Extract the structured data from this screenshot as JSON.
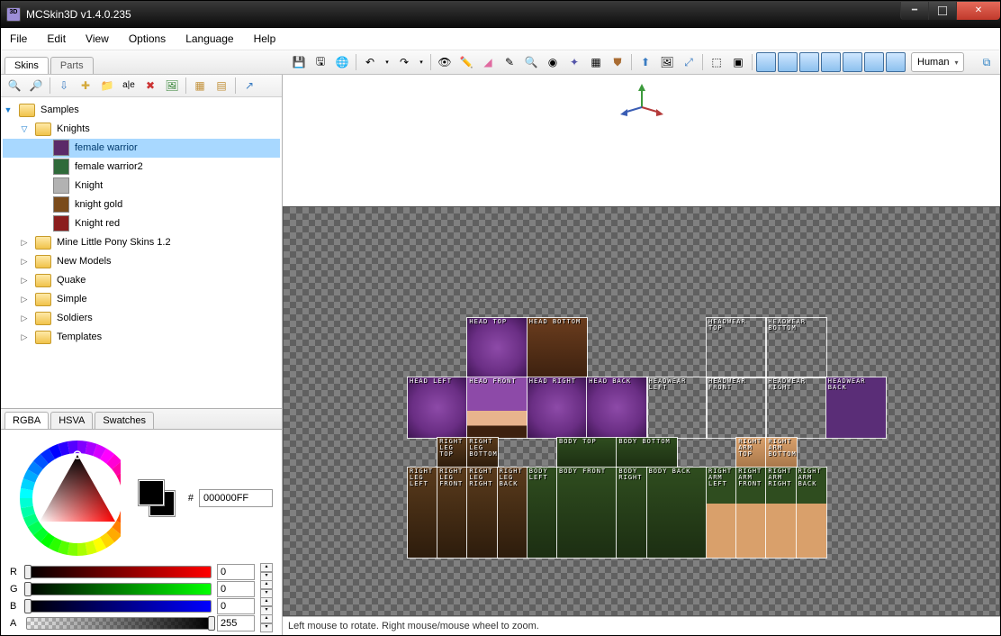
{
  "window": {
    "title": "MCSkin3D  v1.4.0.235"
  },
  "menu": [
    "File",
    "Edit",
    "View",
    "Options",
    "Language",
    "Help"
  ],
  "fileTabs": [
    {
      "label": "Skins",
      "active": true
    },
    {
      "label": "Parts",
      "active": false
    }
  ],
  "model_selector": "Human",
  "tree": {
    "root": "Samples",
    "open_folder": "Knights",
    "skins": [
      {
        "label": "female warrior",
        "selected": true,
        "bg": "#5b2a68"
      },
      {
        "label": "female warrior2",
        "selected": false,
        "bg": "#2f6a3a"
      },
      {
        "label": "Knight",
        "selected": false,
        "bg": "#b2b2b2"
      },
      {
        "label": "knight gold",
        "selected": false,
        "bg": "#7a4b1b"
      },
      {
        "label": "Knight red",
        "selected": false,
        "bg": "#8b1d1d"
      }
    ],
    "folders": [
      "Mine Little Pony Skins 1.2",
      "New Models",
      "Quake",
      "Simple",
      "Soldiers",
      "Templates"
    ]
  },
  "colorTabs": [
    "RGBA",
    "HSVA",
    "Swatches"
  ],
  "color": {
    "hex_prefix": "#",
    "hex": "000000FF",
    "channels": [
      {
        "name": "R",
        "value": "0",
        "cls": "r",
        "pos": 0
      },
      {
        "name": "G",
        "value": "0",
        "cls": "g",
        "pos": 0
      },
      {
        "name": "B",
        "value": "0",
        "cls": "b",
        "pos": 0
      },
      {
        "name": "A",
        "value": "255",
        "cls": "a",
        "pos": 100
      }
    ]
  },
  "status": "Left mouse to rotate. Right mouse/mouse wheel to zoom.",
  "uvlabels": {
    "head": [
      "HEAD TOP",
      "HEAD BOTTOM",
      "HEAD LEFT",
      "HEAD FRONT",
      "HEAD RIGHT",
      "HEAD BACK"
    ],
    "headwear": [
      "HEADWEAR TOP",
      "HEADWEAR BOTTOM",
      "HEADWEAR LEFT",
      "HEADWEAR FRONT",
      "HEADWEAR RIGHT",
      "HEADWEAR BACK"
    ],
    "body": [
      "BODY TOP",
      "BODY BOTTOM",
      "BODY LEFT",
      "BODY FRONT",
      "BODY RIGHT",
      "BODY BACK"
    ],
    "rleg": [
      "RIGHT LEG TOP",
      "RIGHT LEG BOTTOM",
      "RIGHT LEG LEFT",
      "RIGHT LEG FRONT",
      "RIGHT LEG RIGHT",
      "RIGHT LEG BACK"
    ],
    "rarm": [
      "RIGHT ARM TOP",
      "RIGHT ARM BOTTOM",
      "RIGHT ARM LEFT",
      "RIGHT ARM FRONT",
      "RIGHT ARM RIGHT",
      "RIGHT ARM BACK"
    ]
  }
}
